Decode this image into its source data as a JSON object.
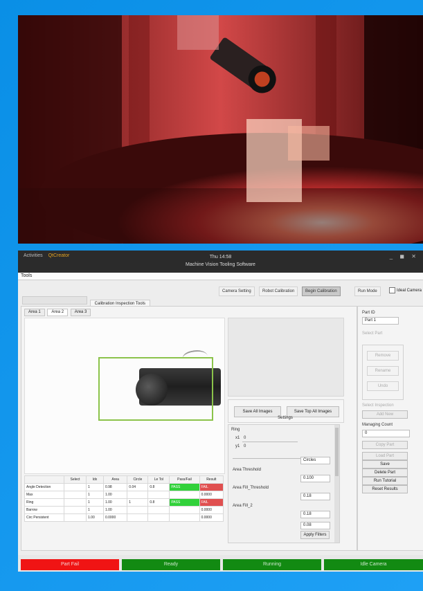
{
  "titlebar": {
    "menu_label": "Activities",
    "app_name": "QtCreator",
    "time": "Thu 14:58",
    "window_title": "Machine Vision Tooling Software",
    "window_controls": "_ ◼ ✕"
  },
  "menu": {
    "file": "Tools"
  },
  "toolbar": {
    "items": [
      "Camera Setting",
      "Robot Calibration",
      "Begin Calibration",
      "Run Mode"
    ],
    "active": "Begin Calibration",
    "check_label": "Ideal Camera"
  },
  "top_tabs": [
    "",
    "Calibration Inspection Tools"
  ],
  "sub_tabs": [
    "Area 1",
    "Area 2",
    "Area 3"
  ],
  "buttons": {
    "save_all": "Save All Images",
    "save_top": "Save Top All Images"
  },
  "section_title": "Settings",
  "settings": {
    "group1": "Ring",
    "x_label": "x1",
    "y_label": "y1",
    "x_val": "0",
    "y_val": "0",
    "spin1": "Circles",
    "label2": "Area Threshold",
    "spin2": "0.100",
    "label3": "Area Fill_Threshold",
    "spin3": "0.18",
    "label4": "Area Fill_2",
    "spin4": "0.18",
    "spin5": "0.08",
    "apply": "Apply Filters"
  },
  "table": {
    "headers": [
      "",
      "Select",
      "Idx",
      "Area",
      "Circle",
      "Le Tol",
      "Pass/Fail",
      "Result"
    ],
    "rows": [
      [
        "Angle Detection",
        "",
        "1",
        "0.98",
        "0.04",
        "0.8",
        "PASS",
        "FAIL"
      ],
      [
        "Max",
        "",
        "1",
        "1.00",
        "",
        "",
        "",
        "0.0000"
      ],
      [
        "Ring",
        "",
        "1",
        "1.00",
        "1",
        "0.8",
        "PASS",
        "FAIL"
      ],
      [
        "Barrow",
        "",
        "1",
        "1.00",
        "",
        "",
        "",
        "0.0000"
      ],
      [
        "Circ Persistent",
        "",
        "1.00",
        "0.0000",
        "",
        "",
        "",
        "0.0000"
      ]
    ]
  },
  "side": {
    "part_label": "Part ID",
    "part_value": "Part 1",
    "group_label": "Select Part",
    "group_buttons": [
      "Remove",
      "Rename",
      "Undo"
    ],
    "mid_label": "Select Inspection",
    "mid_button": "Add New",
    "inspect_label": "Managing Count",
    "inspect_value": "0",
    "disabled_button": "Copy Part",
    "save_label": "Load Part",
    "actions": [
      "Save",
      "Delete Part",
      "Run Tutorial",
      "Reset Results"
    ]
  },
  "status_bar": [
    {
      "label": "Part Fail",
      "color": "#f01414"
    },
    {
      "label": "Ready",
      "color": "#128a12"
    },
    {
      "label": "Running",
      "color": "#128a12"
    },
    {
      "label": "Idle Camera",
      "color": "#128a12"
    }
  ],
  "colors": {
    "frame": "#1e90ff",
    "pass": "#31d13a",
    "fail": "#e05050",
    "roi": "#8bc34a"
  }
}
